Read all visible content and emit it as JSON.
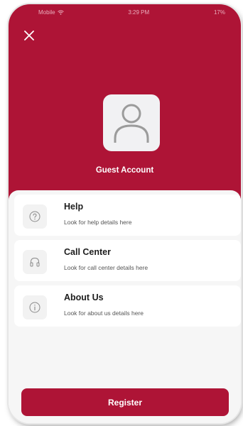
{
  "status_bar": {
    "carrier": "Mobile",
    "time": "3:29 PM",
    "battery": "17%"
  },
  "header": {
    "close_icon": "close-icon",
    "account_label": "Guest Account",
    "avatar_icon": "user-avatar-icon"
  },
  "menu": {
    "items": [
      {
        "title": "Help",
        "subtitle": "Look for help details here",
        "icon": "help-icon"
      },
      {
        "title": "Call Center",
        "subtitle": "Look for call center details here",
        "icon": "headphones-icon"
      },
      {
        "title": "About Us",
        "subtitle": "Look for about us details here",
        "icon": "info-icon"
      }
    ]
  },
  "actions": {
    "register_label": "Register"
  },
  "colors": {
    "brand": "#ae1436",
    "sheet_background": "#f6f6f6",
    "text": "#1d1d1d"
  }
}
